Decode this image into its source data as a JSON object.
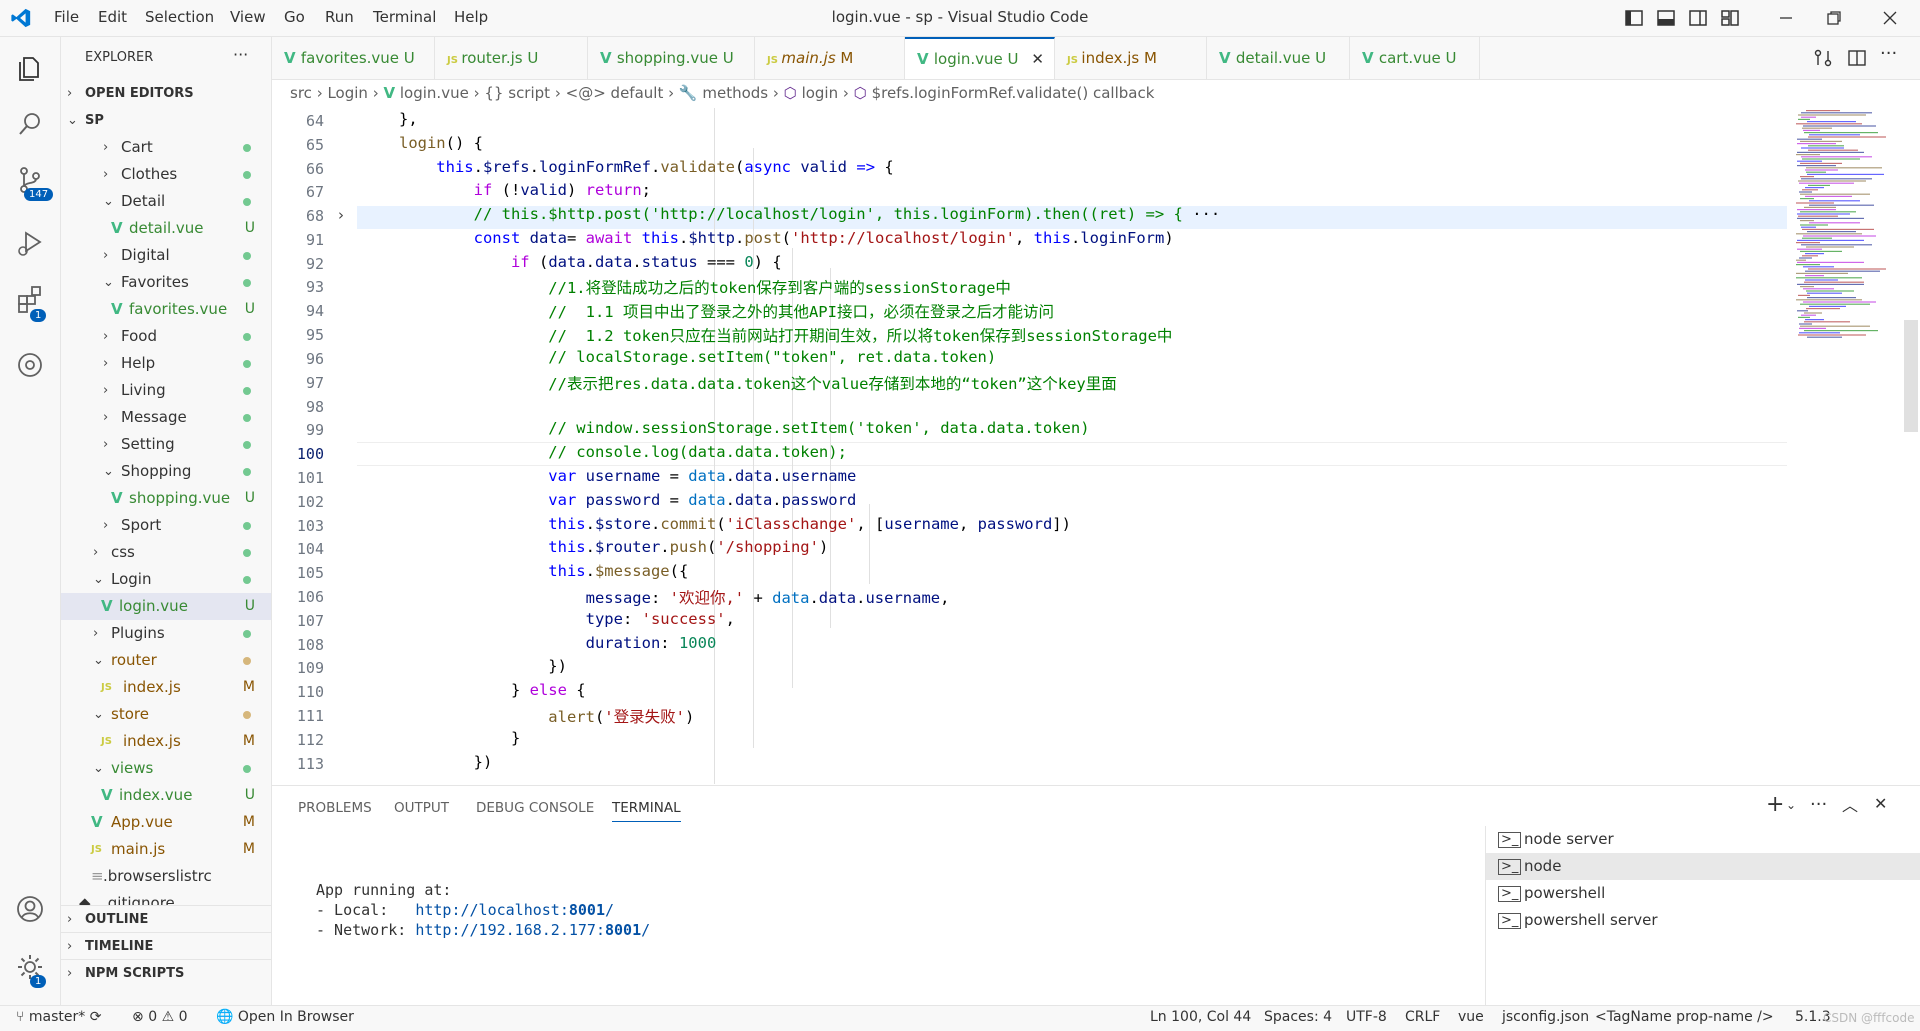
{
  "window": {
    "title": "login.vue - sp - Visual Studio Code",
    "menu": [
      "File",
      "Edit",
      "Selection",
      "View",
      "Go",
      "Run",
      "Terminal",
      "Help"
    ]
  },
  "activity": {
    "scm_badge": "147",
    "extensions_badge": "1",
    "manage_badge": "1"
  },
  "sidebar": {
    "title": "EXPLORER",
    "more": "···",
    "open_editors": "OPEN EDITORS",
    "root": "SP",
    "items": [
      {
        "label": "Cart",
        "status": ""
      },
      {
        "label": "Clothes",
        "status": ""
      },
      {
        "label": "Detail",
        "status": ""
      },
      {
        "label": "detail.vue",
        "status": "U"
      },
      {
        "label": "Digital",
        "status": ""
      },
      {
        "label": "Favorites",
        "status": ""
      },
      {
        "label": "favorites.vue",
        "status": "U"
      },
      {
        "label": "Food",
        "status": ""
      },
      {
        "label": "Help",
        "status": ""
      },
      {
        "label": "Living",
        "status": ""
      },
      {
        "label": "Message",
        "status": ""
      },
      {
        "label": "Setting",
        "status": ""
      },
      {
        "label": "Shopping",
        "status": ""
      },
      {
        "label": "shopping.vue",
        "status": "U"
      },
      {
        "label": "Sport",
        "status": ""
      },
      {
        "label": "css",
        "status": ""
      },
      {
        "label": "Login",
        "status": ""
      },
      {
        "label": "login.vue",
        "status": "U"
      },
      {
        "label": "Plugins",
        "status": ""
      },
      {
        "label": "router",
        "status": ""
      },
      {
        "label": "index.js",
        "status": "M"
      },
      {
        "label": "store",
        "status": ""
      },
      {
        "label": "index.js",
        "status": "M"
      },
      {
        "label": "views",
        "status": ""
      },
      {
        "label": "index.vue",
        "status": "U"
      },
      {
        "label": "App.vue",
        "status": "M"
      },
      {
        "label": "main.js",
        "status": "M"
      },
      {
        "label": ".browserslistrc",
        "status": ""
      },
      {
        "label": ".gitignore",
        "status": ""
      }
    ],
    "outline": "OUTLINE",
    "timeline": "TIMELINE",
    "npm_scripts": "NPM SCRIPTS"
  },
  "tabs": [
    {
      "label": "favorites.vue",
      "status": "U"
    },
    {
      "label": "router.js",
      "status": "U"
    },
    {
      "label": "shopping.vue",
      "status": "U"
    },
    {
      "label": "main.js",
      "status": "M"
    },
    {
      "label": "login.vue",
      "status": "U"
    },
    {
      "label": "index.js",
      "status": "M"
    },
    {
      "label": "detail.vue",
      "status": "U"
    },
    {
      "label": "cart.vue",
      "status": "U"
    }
  ],
  "breadcrumb": [
    "src",
    "Login",
    "login.vue",
    "script",
    "default",
    "methods",
    "login",
    "$refs.loginFormRef.validate() callback"
  ],
  "editor": {
    "line_numbers": [
      "64",
      "65",
      "66",
      "67",
      "68",
      "91",
      "92",
      "93",
      "94",
      "95",
      "96",
      "97",
      "98",
      "99",
      "100",
      "101",
      "102",
      "103",
      "104",
      "105",
      "106",
      "107",
      "108",
      "109",
      "110",
      "111",
      "112",
      "113"
    ],
    "current_line": "100"
  },
  "panel": {
    "tabs": [
      "PROBLEMS",
      "OUTPUT",
      "DEBUG CONSOLE",
      "TERMINAL"
    ],
    "terminal": {
      "line1": "App running at:",
      "local_label": "- Local:   ",
      "local_url": "http://localhost:",
      "local_port": "8001",
      "network_label": "- Network: ",
      "network_url": "http://192.168.2.177:",
      "network_port": "8001",
      "slash": "/"
    },
    "terminals": [
      "node server",
      "node",
      "powershell",
      "powershell server"
    ]
  },
  "status": {
    "branch": "master*",
    "errors": "0",
    "warnings": "0",
    "open_browser": "Open In Browser",
    "position": "Ln 100, Col 44",
    "spaces": "Spaces: 4",
    "encoding": "UTF-8",
    "eol": "CRLF",
    "language": "vue",
    "jsconfig": "jsconfig.json",
    "tagname": "<TagName prop-name />",
    "version": "5.1.3",
    "watermark": "CSDN @fffcode"
  }
}
